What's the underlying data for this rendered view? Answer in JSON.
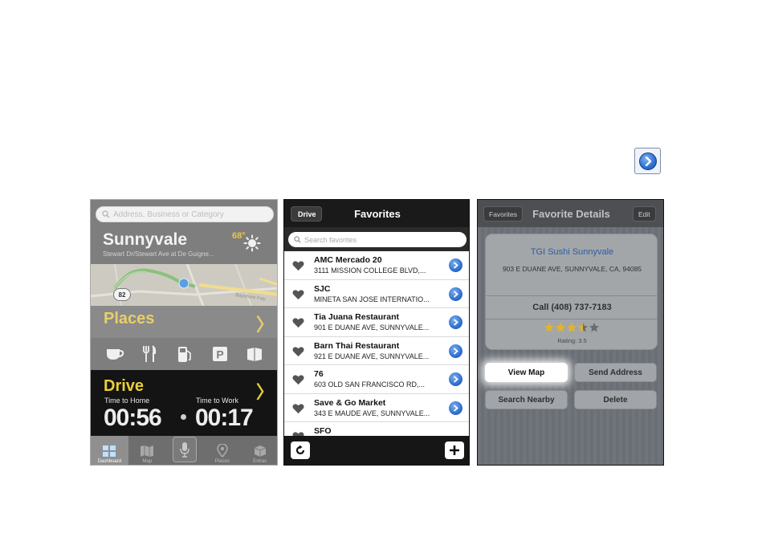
{
  "dashboard": {
    "search_placeholder": "Address, Business or Category",
    "city": "Sunnyvale",
    "street": "Stewart Dr/Stewart Ave at De Guigne...",
    "temperature": "68°",
    "map_route_label": "82",
    "map_street_label": "Bayshore Fwy",
    "places_label": "Places",
    "places_chevron": "〉",
    "drive_label": "Drive",
    "drive_chevron": "〉",
    "time_home_label": "Time to Home",
    "time_work_label": "Time to Work",
    "time_home": "00:56",
    "time_work": "00:17",
    "tabs": [
      {
        "label": "Dashboard"
      },
      {
        "label": "Map"
      },
      {
        "label": ""
      },
      {
        "label": "Places"
      },
      {
        "label": "Extras"
      }
    ]
  },
  "favorites": {
    "back_label": "Drive",
    "title": "Favorites",
    "search_placeholder": "Search favorites",
    "items": [
      {
        "name": "AMC Mercado 20",
        "address": "3111 MISSION COLLEGE BLVD,..."
      },
      {
        "name": "SJC",
        "address": "MINETA SAN JOSE INTERNATIO..."
      },
      {
        "name": "Tia Juana Restaurant",
        "address": "901 E DUANE AVE, SUNNYVALE..."
      },
      {
        "name": "Barn Thai Restaurant",
        "address": "921 E DUANE AVE, SUNNYVALE..."
      },
      {
        "name": "76",
        "address": "603 OLD SAN FRANCISCO RD,..."
      },
      {
        "name": "Save & Go Market",
        "address": "343 E MAUDE AVE, SUNNYVALE..."
      },
      {
        "name": "SFO",
        "address": ""
      }
    ]
  },
  "details": {
    "back_label": "Favorites",
    "title": "Favorite Details",
    "edit_label": "Edit",
    "name": "TGI Sushi Sunnyvale",
    "address": "903 E DUANE AVE, SUNNYVALE, CA, 94085",
    "call": "Call (408) 737-7183",
    "rating_value": 3.5,
    "rating_max": 5,
    "rating_text": "Rating: 3.5",
    "buttons": {
      "view_map": "View Map",
      "send_address": "Send Address",
      "search_nearby": "Search Nearby",
      "delete": "Delete"
    }
  },
  "colors": {
    "accent_yellow": "#e8cf3a",
    "accent_blue": "#2e6fd0",
    "link_blue": "#2b5fa0"
  }
}
